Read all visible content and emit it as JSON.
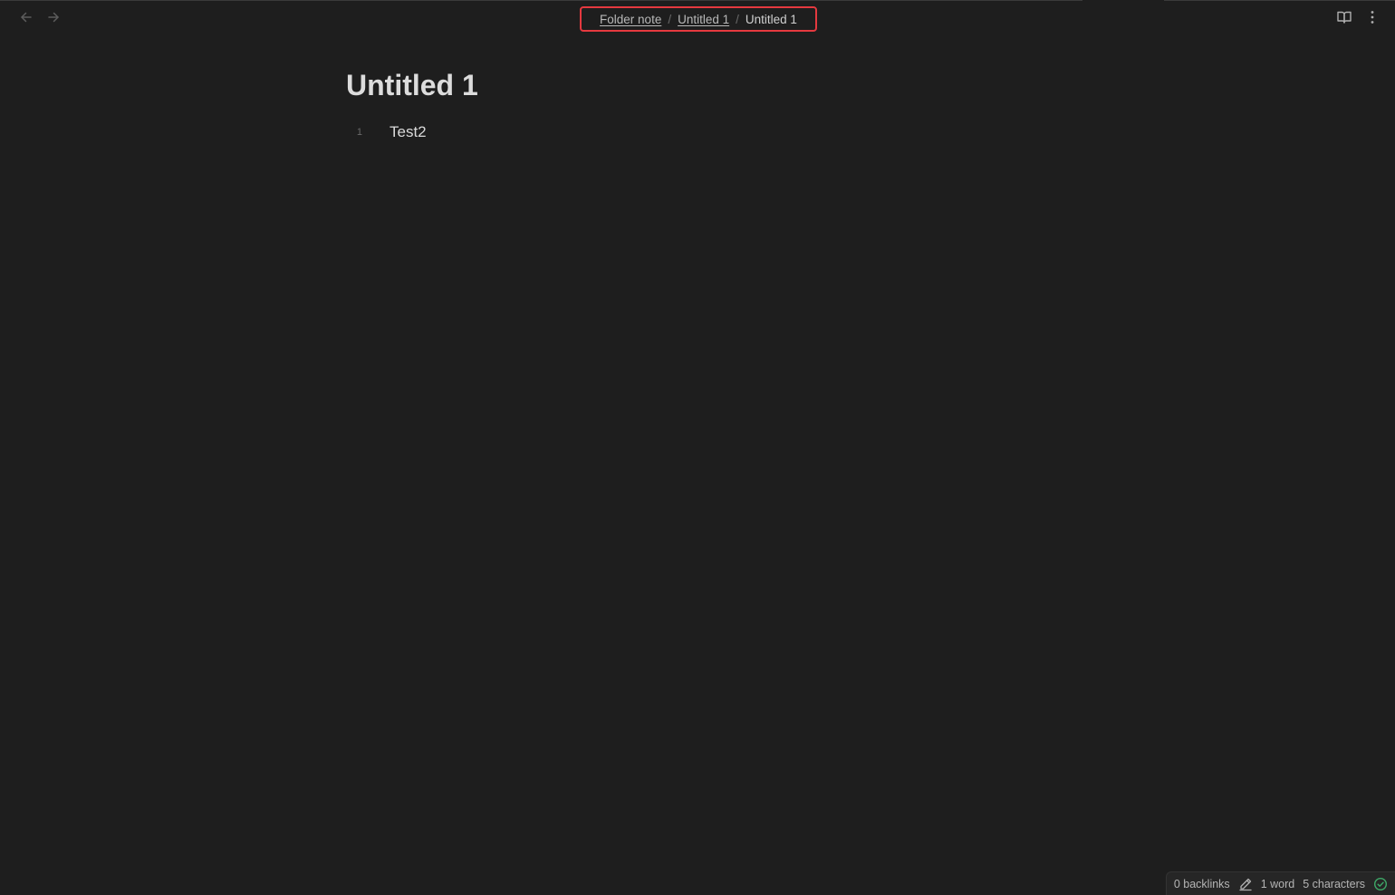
{
  "breadcrumb": {
    "items": [
      {
        "label": "Folder note",
        "type": "link"
      },
      {
        "label": "Untitled 1",
        "type": "link"
      },
      {
        "label": "Untitled 1",
        "type": "current"
      }
    ],
    "separator": "/",
    "highlight_color": "#e5393f"
  },
  "note": {
    "title": "Untitled 1",
    "lines": [
      {
        "number": "1",
        "text": "Test2"
      }
    ]
  },
  "status_bar": {
    "backlinks": "0 backlinks",
    "edit_icon": "pencil-icon",
    "word_count": "1 word",
    "char_count": "5 characters",
    "sync_icon": "sync-check-icon",
    "sync_color": "#3ea968"
  },
  "icons": {
    "back": "arrow-left-icon",
    "forward": "arrow-right-icon",
    "reading_view": "book-open-icon",
    "more": "more-vertical-icon"
  }
}
